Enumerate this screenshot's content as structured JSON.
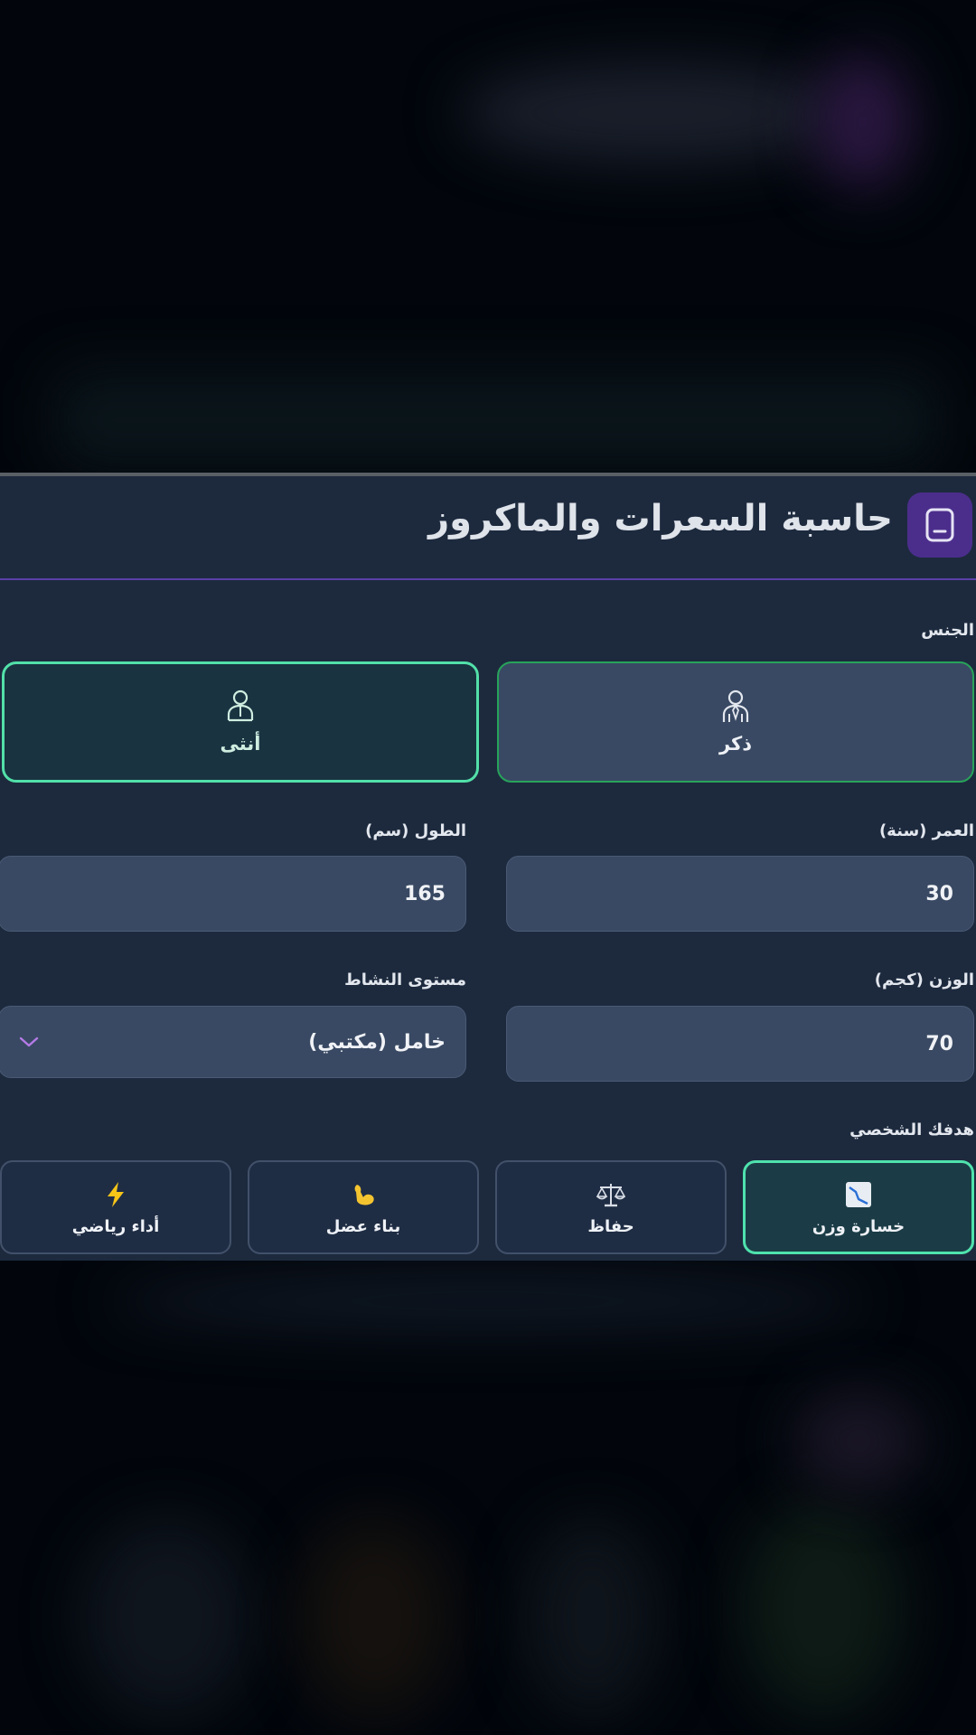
{
  "app": {
    "title": "حاسبة السعرات والماكروز",
    "icon": "calculator-icon",
    "accent": "#4b2e8c"
  },
  "form": {
    "gender": {
      "label": "الجنس",
      "options": [
        {
          "label": "ذكر",
          "icon": "male-person-icon",
          "selected": false
        },
        {
          "label": "أنثى",
          "icon": "female-person-icon",
          "selected": true
        }
      ]
    },
    "age": {
      "label": "العمر (سنة)",
      "value": "30"
    },
    "height": {
      "label": "الطول (سم)",
      "value": "165"
    },
    "weight": {
      "label": "الوزن (كجم)",
      "value": "70"
    },
    "activity": {
      "label": "مستوى النشاط",
      "value": "خامل (مكتبي)",
      "icon": "chevron-down-icon"
    },
    "goal": {
      "label": "هدفك الشخصي",
      "options": [
        {
          "label": "خسارة وزن",
          "icon": "chart-down-icon",
          "selected": true
        },
        {
          "label": "حفاظ",
          "icon": "balance-scale-icon",
          "selected": false
        },
        {
          "label": "بناء عضل",
          "icon": "flexed-biceps-icon",
          "selected": false
        },
        {
          "label": "أداء رياضي",
          "icon": "lightning-icon",
          "selected": false
        }
      ]
    }
  },
  "colors": {
    "panel": "#1d2a3e",
    "input": "#394963",
    "selected_border": "#52e0a9",
    "male_border": "#27a35a"
  }
}
